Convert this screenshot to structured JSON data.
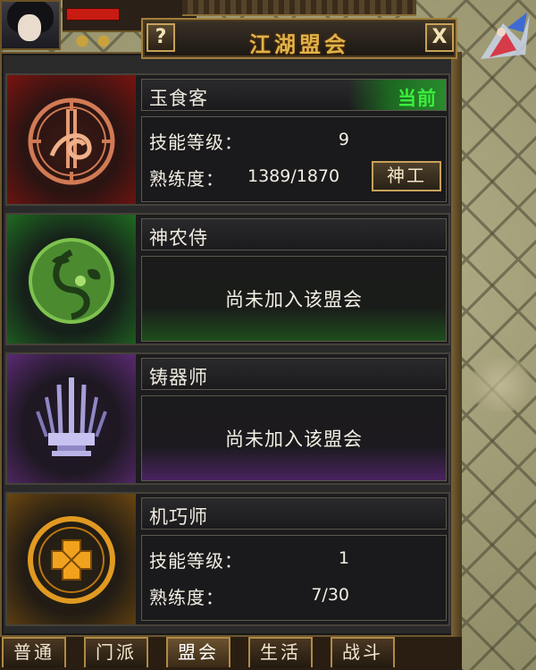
{
  "window": {
    "title": "江湖盟会",
    "help_label": "?",
    "close_label": "X"
  },
  "guilds": [
    {
      "name": "玉食客",
      "emblem_icon": "yushike-emblem-icon",
      "theme_color": "#8a1d18",
      "status_tag": "当前",
      "skill_level_label": "技能等级：",
      "skill_level": "9",
      "proficiency_label": "熟练度：",
      "proficiency": "1389/1870",
      "action_label": "神工"
    },
    {
      "name": "神农侍",
      "emblem_icon": "shennongshi-emblem-icon",
      "theme_color": "#2f7d26",
      "message": "尚未加入该盟会"
    },
    {
      "name": "铸器师",
      "emblem_icon": "zhuqishi-emblem-icon",
      "theme_color": "#6a2f8a",
      "message": "尚未加入该盟会"
    },
    {
      "name": "机巧师",
      "emblem_icon": "jiqiaoshi-emblem-icon",
      "theme_color": "#8a5d12",
      "skill_level_label": "技能等级：",
      "skill_level": "1",
      "proficiency_label": "熟练度：",
      "proficiency": "7/30"
    }
  ],
  "tabs": [
    {
      "label": "普通"
    },
    {
      "label": "门派"
    },
    {
      "label": "盟会",
      "active": true
    },
    {
      "label": "生活"
    },
    {
      "label": "战斗"
    }
  ],
  "colors": {
    "gold_title": "#e0b24a",
    "current_green": "#3cf03c",
    "panel_bg": "#2b2a2b"
  }
}
